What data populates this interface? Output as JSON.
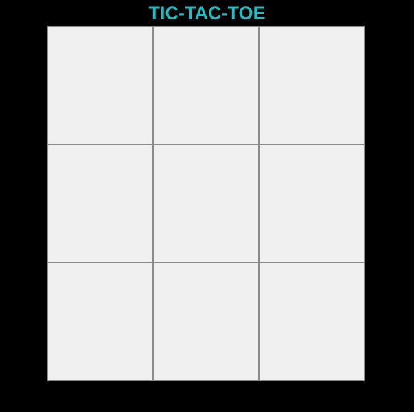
{
  "title": "TIC-TAC-TOE",
  "colors": {
    "background": "#000000",
    "title": "#1bbfc4",
    "cell": "#f0f0f0",
    "grid_line": "#8a8a8a"
  },
  "board": {
    "cells": [
      "",
      "",
      "",
      "",
      "",
      "",
      "",
      "",
      ""
    ]
  }
}
